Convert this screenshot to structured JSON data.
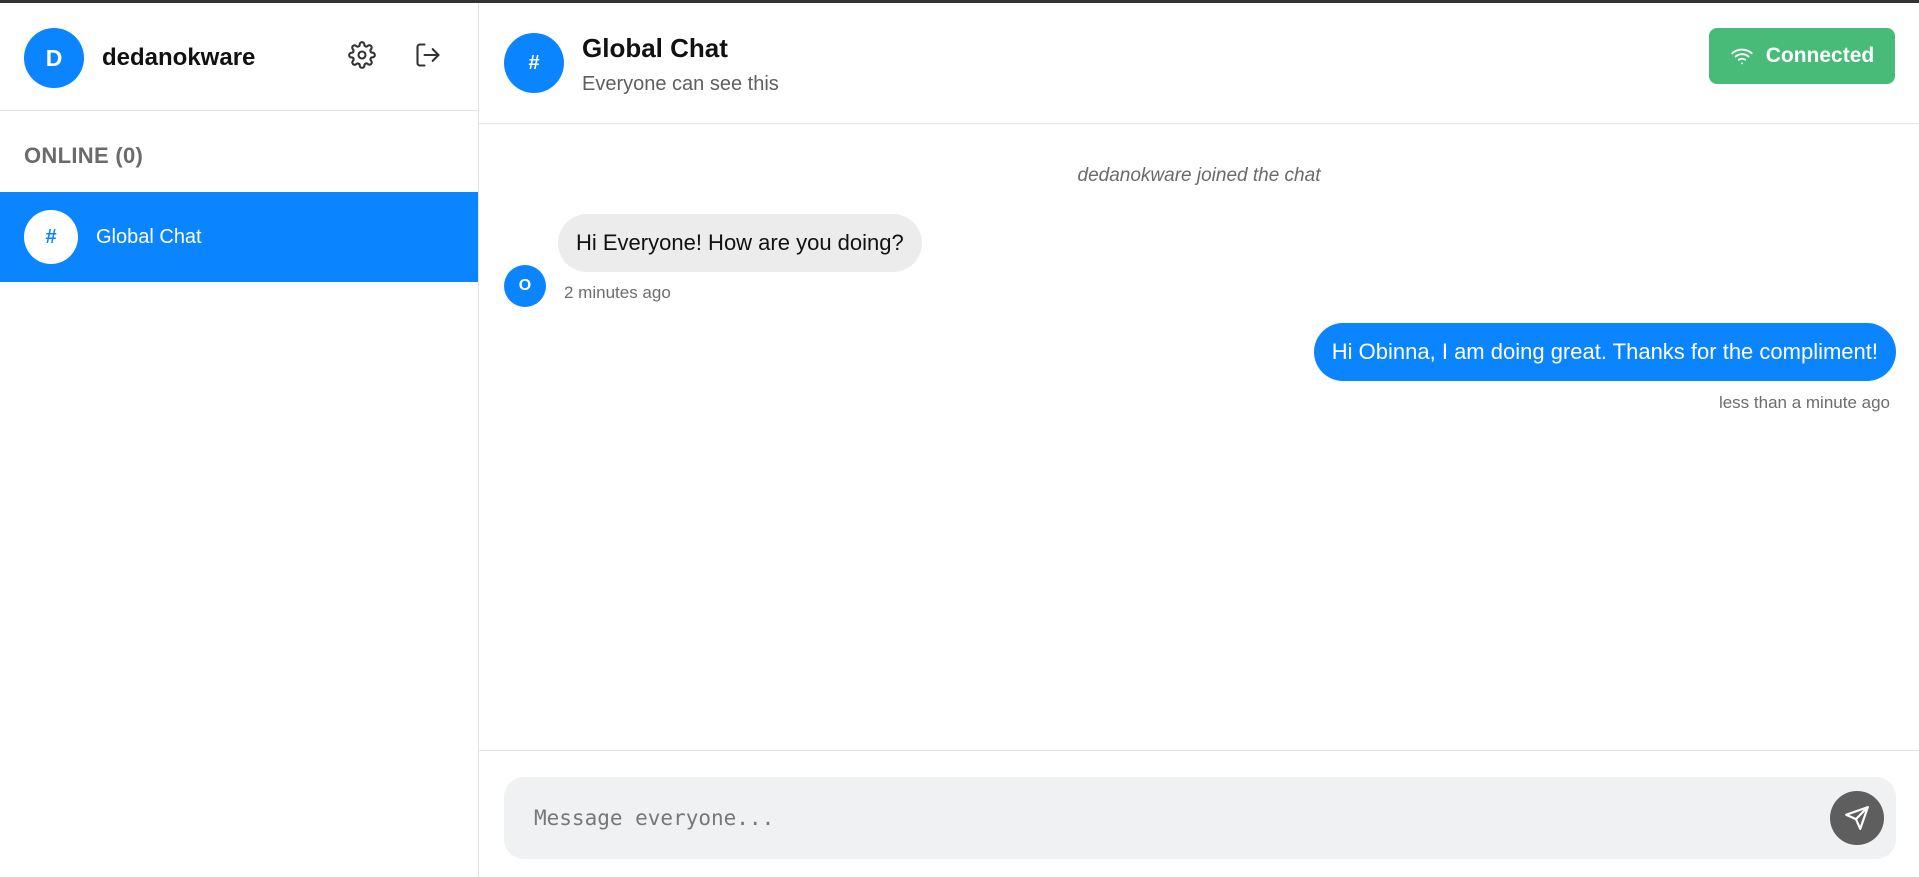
{
  "sidebar": {
    "user": {
      "initial": "D",
      "name": "dedanokware"
    },
    "online_header": "ONLINE (0)",
    "channels": [
      {
        "icon_glyph": "#",
        "label": "Global Chat",
        "active": true
      }
    ]
  },
  "chat": {
    "icon_glyph": "#",
    "title": "Global Chat",
    "subtitle": "Everyone can see this",
    "status": {
      "label": "Connected",
      "color": "#48bb78"
    }
  },
  "messages": [
    {
      "type": "system",
      "text": "dedanokware joined the chat"
    },
    {
      "type": "incoming",
      "avatar_initial": "O",
      "text": "Hi Everyone! How are you doing?",
      "time": "2 minutes ago"
    },
    {
      "type": "outgoing",
      "text": "Hi Obinna, I am doing great. Thanks for the compliment!",
      "time": "less than a minute ago"
    }
  ],
  "composer": {
    "placeholder": "Message everyone..."
  },
  "colors": {
    "accent": "#0a84ff",
    "success": "#48bb78",
    "send_button": "#5e5e5e"
  },
  "icons": {
    "settings": "gear-icon",
    "logout": "logout-icon",
    "status": "wifi-icon",
    "send": "send-icon"
  }
}
